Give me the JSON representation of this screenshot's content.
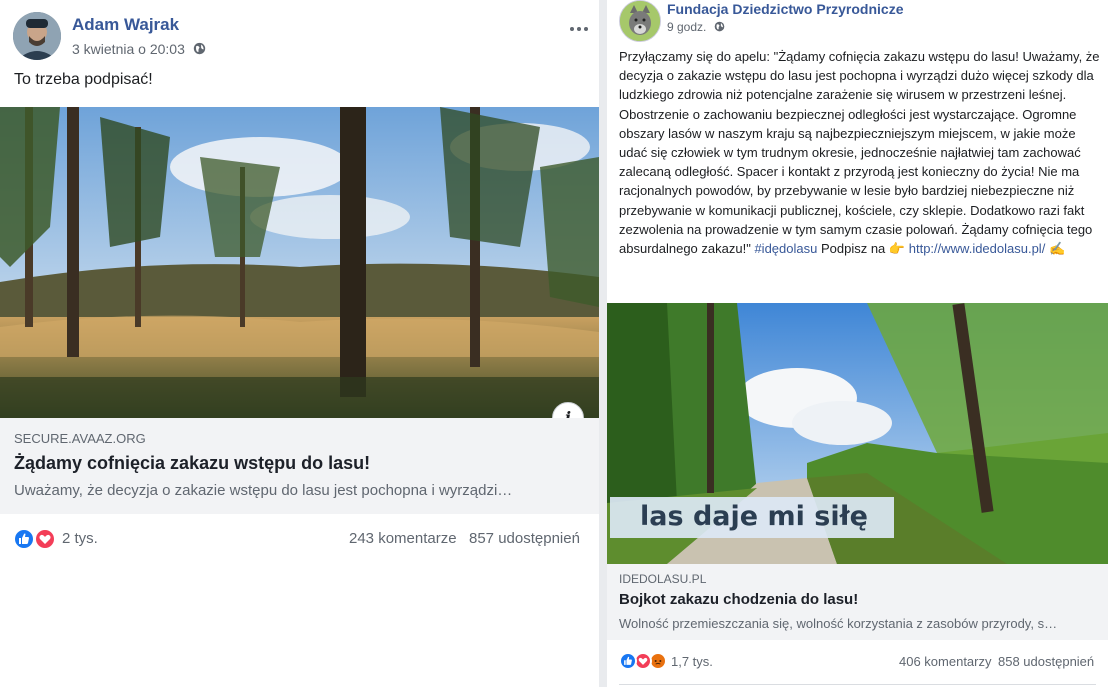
{
  "left_post": {
    "author": "Adam Wajrak",
    "timestamp": "3 kwietnia o 20:03",
    "privacy_icon": "globe-icon",
    "text": "To trzeba podpisać!",
    "link": {
      "domain": "SECURE.AVAAZ.ORG",
      "title": "Żądamy cofnięcia zakazu wstępu do lasu!",
      "description": "Uważamy, że decyzja o zakazie wstępu do lasu jest pochopna i wyrządzi…"
    },
    "info_icon": "i",
    "reactions": [
      "like-icon",
      "love-icon"
    ],
    "reaction_count": "2 tys.",
    "comments": "243 komentarze",
    "shares": "857 udostępnień"
  },
  "right_post": {
    "author": "Fundacja Dziedzictwo Przyrodnicze",
    "timestamp": "9 godz.",
    "privacy_icon": "globe-icon",
    "text": "Przyłączamy się do apelu: \"Żądamy cofnięcia zakazu wstępu do lasu! Uważamy, że decyzja o zakazie wstępu do lasu jest pochopna i wyrządzi dużo więcej szkody dla ludzkiego zdrowia niż potencjalne zarażenie się wirusem w przestrzeni leśnej. Obostrzenie o zachowaniu bezpiecznej odległości jest wystarczające. Ogromne obszary lasów w naszym kraju są najbezpieczniejszym miejscem, w jakie może udać się człowiek w tym trudnym okresie, jednocześnie najłatwiej tam zachować zalecaną odległość. Spacer i kontakt z przyrodą jest konieczny do życia! Nie ma racjonalnych powodów, by przebywanie w lesie było bardziej niebezpieczne niż przebywanie w komunikacji publicznej, kościele, czy sklepie. Dodatkowo razi fakt zezwolenia na prowadzenie w tym samym czasie polowań. Żądamy cofnięcia tego absurdalnego zakazu!\"",
    "hashtag": "#idędolasu",
    "after_hashtag": "Podpisz na",
    "point_emoji": "👉",
    "url": "http://www.idedolasu.pl/",
    "write_emoji": "✍",
    "image_caption": "las daje mi siłę",
    "link": {
      "domain": "IDEDOLASU.PL",
      "title": "Bojkot zakazu chodzenia do lasu!",
      "description": "Wolność przemieszczania się, wolność korzystania z zasobów przyrody, s…"
    },
    "reactions": [
      "like-icon",
      "love-icon",
      "angry-icon"
    ],
    "reaction_count": "1,7 tys.",
    "comments": "406 komentarzy",
    "shares": "858 udostępnień"
  },
  "colors": {
    "name_blue": "#385898",
    "meta_gray": "#606770",
    "like_blue": "#1877f2",
    "love_red": "#f33e58",
    "angry_orange": "#e9710f"
  }
}
